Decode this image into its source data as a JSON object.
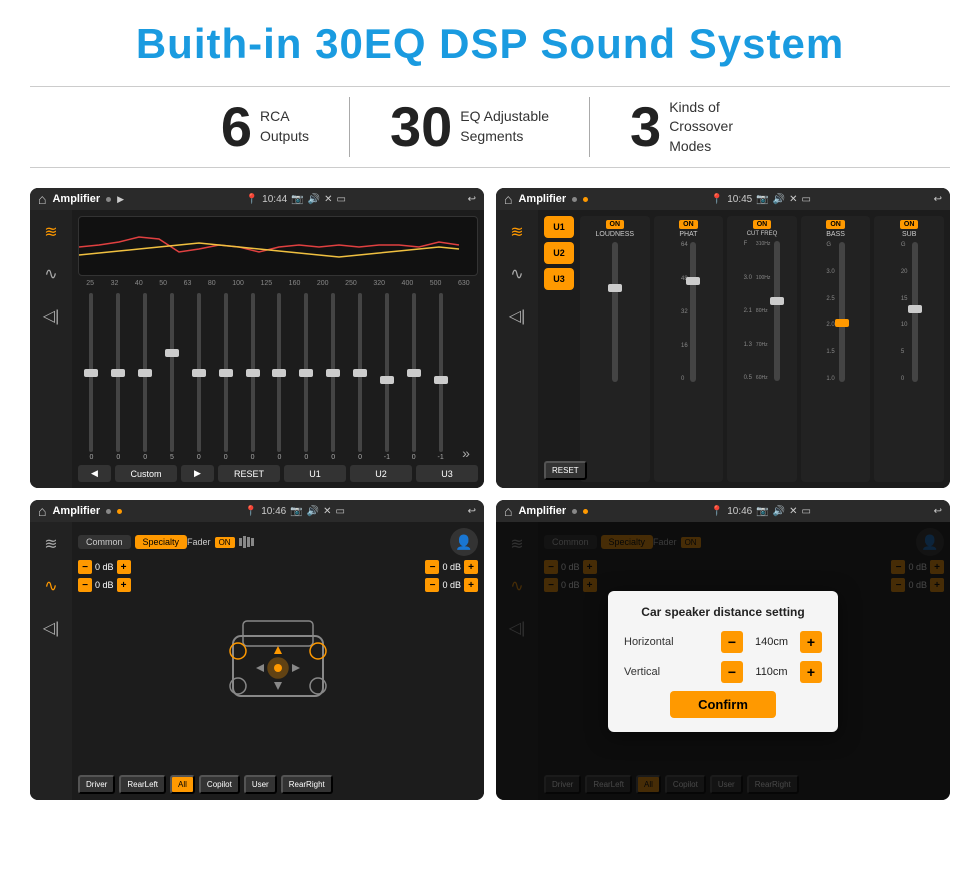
{
  "page": {
    "title": "Buith-in 30EQ DSP Sound System",
    "stats": [
      {
        "number": "6",
        "text": "RCA\nOutputs"
      },
      {
        "number": "30",
        "text": "EQ Adjustable\nSegments"
      },
      {
        "number": "3",
        "text": "Kinds of\nCrossover Modes"
      }
    ]
  },
  "screens": {
    "screen1": {
      "appName": "Amplifier",
      "time": "10:44",
      "eq_freqs": [
        "25",
        "32",
        "40",
        "50",
        "63",
        "80",
        "100",
        "125",
        "160",
        "200",
        "250",
        "320",
        "400",
        "500",
        "630"
      ],
      "eq_values": [
        "0",
        "0",
        "0",
        "5",
        "0",
        "0",
        "0",
        "0",
        "0",
        "0",
        "0",
        "-1",
        "0",
        "-1"
      ],
      "bottomBtns": [
        "◀",
        "Custom",
        "▶",
        "RESET",
        "U1",
        "U2",
        "U3"
      ]
    },
    "screen2": {
      "appName": "Amplifier",
      "time": "10:45",
      "presets": [
        "U1",
        "U2",
        "U3"
      ],
      "channels": [
        {
          "name": "LOUDNESS",
          "on": true
        },
        {
          "name": "PHAT",
          "on": true
        },
        {
          "name": "CUT FREQ",
          "on": true
        },
        {
          "name": "BASS",
          "on": true
        },
        {
          "name": "SUB",
          "on": true
        }
      ],
      "resetLabel": "RESET"
    },
    "screen3": {
      "appName": "Amplifier",
      "time": "10:46",
      "tabs": [
        "Common",
        "Specialty"
      ],
      "faderLabel": "Fader",
      "faderOn": "ON",
      "dbValues": [
        "0 dB",
        "0 dB",
        "0 dB",
        "0 dB"
      ],
      "bottomBtns": [
        "Driver",
        "RearLeft",
        "All",
        "Copilot",
        "RearRight",
        "User"
      ]
    },
    "screen4": {
      "appName": "Amplifier",
      "time": "10:46",
      "tabs": [
        "Common",
        "Specialty"
      ],
      "dialog": {
        "title": "Car speaker distance setting",
        "horizontal": "Horizontal",
        "horizontalValue": "140cm",
        "vertical": "Vertical",
        "verticalValue": "110cm",
        "confirmLabel": "Confirm"
      },
      "dbValues": [
        "0 dB",
        "0 dB"
      ],
      "bottomBtns": [
        "Driver",
        "RearLeft",
        "All",
        "Copilot",
        "RearRight",
        "User"
      ]
    }
  },
  "icons": {
    "home": "⌂",
    "back": "↩",
    "location": "📍",
    "camera": "📷",
    "speaker": "🔊",
    "close": "✕",
    "window": "▭",
    "eq": "≋",
    "wave": "∿",
    "speaker2": "◁|",
    "chevron_right": "»",
    "chevron_down": "▾",
    "user": "👤",
    "arrow_up": "▲",
    "arrow_down": "▾",
    "arrow_left": "◄",
    "arrow_right": "►"
  }
}
